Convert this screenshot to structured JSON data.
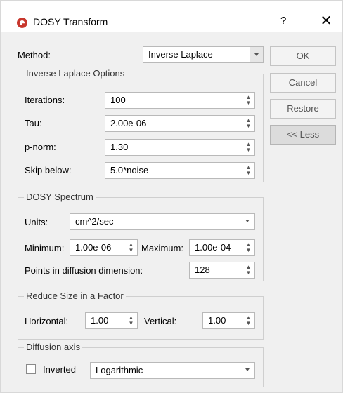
{
  "window": {
    "title": "DOSY Transform",
    "help": "?",
    "close": "✕"
  },
  "method": {
    "label": "Method:",
    "value": "Inverse Laplace"
  },
  "buttons": {
    "ok": "OK",
    "cancel": "Cancel",
    "restore": "Restore",
    "less": "<< Less"
  },
  "inverse_laplace": {
    "title": "Inverse Laplace Options",
    "iterations": {
      "label": "Iterations:",
      "value": "100"
    },
    "tau": {
      "label": "Tau:",
      "value": "2.00e-06"
    },
    "pnorm": {
      "label": "p-norm:",
      "value": "1.30"
    },
    "skip_below": {
      "label": "Skip below:",
      "value": "5.0*noise"
    }
  },
  "dosy_spectrum": {
    "title": "DOSY Spectrum",
    "units": {
      "label": "Units:",
      "value": "cm^2/sec"
    },
    "minimum": {
      "label": "Minimum:",
      "value": "1.00e-06"
    },
    "maximum": {
      "label": "Maximum:",
      "value": "1.00e-04"
    },
    "points": {
      "label": "Points in diffusion dimension:",
      "value": "128"
    }
  },
  "reduce_size": {
    "title": "Reduce Size in a Factor",
    "horizontal": {
      "label": "Horizontal:",
      "value": "1.00"
    },
    "vertical": {
      "label": "Vertical:",
      "value": "1.00"
    }
  },
  "diffusion_axis": {
    "title": "Diffusion axis",
    "inverted": {
      "label": "Inverted",
      "checked": false
    },
    "scale": {
      "value": "Logarithmic"
    }
  }
}
